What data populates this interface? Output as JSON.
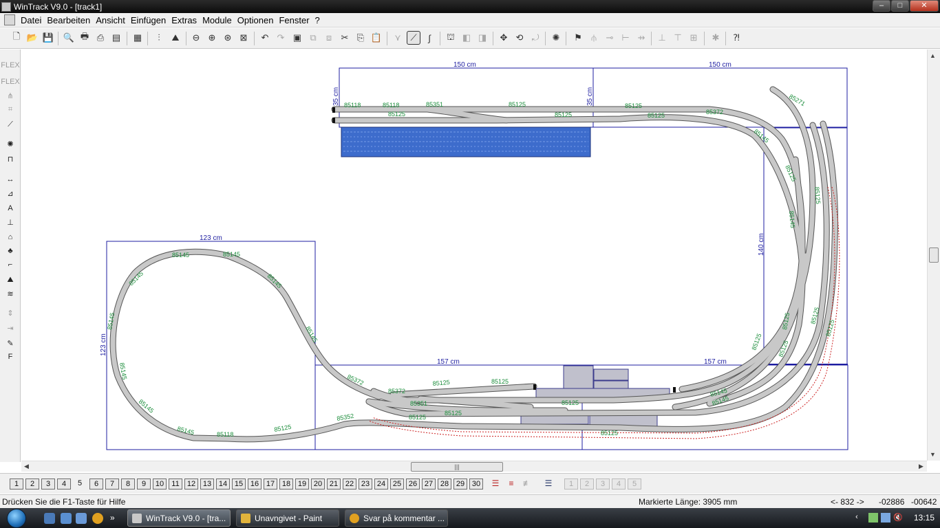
{
  "window": {
    "title": "WinTrack  V9.0 - [track1]"
  },
  "menu": [
    "Datei",
    "Bearbeiten",
    "Ansicht",
    "Einfügen",
    "Extras",
    "Module",
    "Optionen",
    "Fenster",
    "?"
  ],
  "canvas": {
    "dimensions": {
      "top_left": "150 cm",
      "top_right": "150 cm",
      "left_box_top": "123 cm",
      "left_box_side": "123 cm",
      "right_side": "140 cm",
      "bottom_left": "157 cm",
      "bottom_right": "157 cm",
      "top_side_a": "35 cm",
      "top_side_b": "35 cm"
    },
    "track_labels": {
      "t1": "85118",
      "t2": "85118",
      "t3": "85351",
      "t4": "85125",
      "t5": "85125",
      "t6": "85125",
      "t7": "85125",
      "t8": "85125",
      "t9": "85372",
      "t10": "85271",
      "t11": "85145",
      "t12": "85125",
      "t13": "85125",
      "t14": "85145",
      "t15": "85125",
      "t16": "85145",
      "t17": "85145",
      "t18": "85145",
      "t19": "85145",
      "t20": "85145",
      "t21": "85145",
      "t22": "85145",
      "t23": "85145",
      "t24": "85145",
      "t25": "85118",
      "t26": "85125",
      "t27": "85352",
      "t28": "85372",
      "t29": "85372",
      "t30": "85125",
      "t31": "85125",
      "t32": "85351",
      "t33": "85125",
      "t34": "85125",
      "t35": "85125",
      "t36": "85125",
      "t37": "85145",
      "t38": "85145",
      "t39": "85125",
      "t40": "85125",
      "t41": "85125",
      "t42": "85125"
    }
  },
  "layers": {
    "tabs": [
      "1",
      "2",
      "3",
      "4",
      "5",
      "6",
      "7",
      "8",
      "9",
      "10",
      "11",
      "12",
      "13",
      "14",
      "15",
      "16",
      "17",
      "18",
      "19",
      "20",
      "21",
      "22",
      "23",
      "24",
      "25",
      "26",
      "27",
      "28",
      "29",
      "30"
    ],
    "extra": [
      "1",
      "2",
      "3",
      "4",
      "5"
    ]
  },
  "status": {
    "help": "Drücken Sie die  F1-Taste für Hilfe",
    "length": "Markierte Länge: 3905 mm",
    "nav": "<- 832 ->",
    "x": "-02886",
    "y": "-00642"
  },
  "taskbar": {
    "tasks": [
      "WinTrack  V9.0 - [tra...",
      "Unavngivet - Paint",
      "Svar på kommentar ..."
    ],
    "clock": "13:15"
  },
  "colors": {
    "track_fill": "#c8c8c8",
    "dim_line": "#1c1ca0",
    "label": "#1a8c3a",
    "water": "#3d6ccc",
    "path_dotted": "#cc2020"
  }
}
